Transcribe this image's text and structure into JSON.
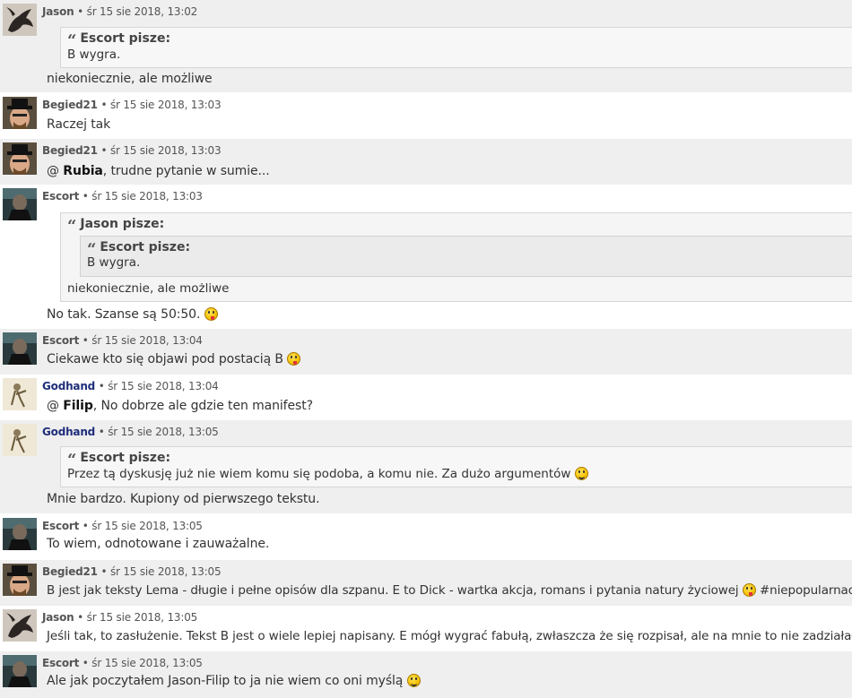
{
  "posts": [
    {
      "author": "Jason",
      "date": "śr 15 sie 2018, 13:02",
      "quote_author": "Escort pisze:",
      "quote_text": "B wygra.",
      "text": "niekoniecznie, ale możliwe"
    },
    {
      "author": "Begied21",
      "date": "śr 15 sie 2018, 13:03",
      "text": "Raczej tak"
    },
    {
      "author": "Begied21",
      "date": "śr 15 sie 2018, 13:03",
      "mention_prefix": "@ ",
      "mention": "Rubia",
      "text": ", trudne pytanie w sumie..."
    },
    {
      "author": "Escort",
      "date": "śr 15 sie 2018, 13:03",
      "quote_author": "Jason pisze:",
      "inner_quote_author": "Escort pisze:",
      "inner_quote_text": "B wygra.",
      "quote_text": "niekoniecznie, ale możliwe",
      "text": "No tak. Szanse są 50:50."
    },
    {
      "author": "Escort",
      "date": "śr 15 sie 2018, 13:04",
      "text": "Ciekawe kto się objawi pod postacią B"
    },
    {
      "author": "Godhand",
      "date": "śr 15 sie 2018, 13:04",
      "mention_prefix": "@ ",
      "mention": "Filip",
      "text": ", No dobrze ale gdzie ten manifest?"
    },
    {
      "author": "Godhand",
      "date": "śr 15 sie 2018, 13:05",
      "quote_author": "Escort pisze:",
      "quote_text": "Przez tą dyskusję już nie wiem komu się podoba, a komu nie. Za dużo argumentów",
      "text": "Mnie bardzo. Kupiony od pierwszego tekstu."
    },
    {
      "author": "Escort",
      "date": "śr 15 sie 2018, 13:05",
      "text": "To wiem, odnotowane i zauważalne."
    },
    {
      "author": "Begied21",
      "date": "śr 15 sie 2018, 13:05",
      "text": "B jest jak teksty Lema - długie i pełne opisów dla szpanu. E to Dick - wartka akcja, romans i pytania natury życiowej",
      "text_after": " #niepopularnaopinia"
    },
    {
      "author": "Jason",
      "date": "śr 15 sie 2018, 13:05",
      "text": "Jeśli tak, to zasłużenie. Tekst B jest o wiele lepiej napisany. E mógł wygrać fabułą, zwłaszcza że się rozpisał, ale na mnie to nie zadziałało."
    },
    {
      "author": "Escort",
      "date": "śr 15 sie 2018, 13:05",
      "text": "Ale jak poczytałem Jason-Filip to ja nie wiem co oni myślą"
    }
  ],
  "separator": "•",
  "colors": {
    "alt_row": "#efefef",
    "moderator_name": "#1f2e7a"
  },
  "icons": {
    "quote": "quote-icon",
    "smiley_tongue": "tongue-smiley-icon",
    "smiley_grin": "grin-smiley-icon"
  }
}
